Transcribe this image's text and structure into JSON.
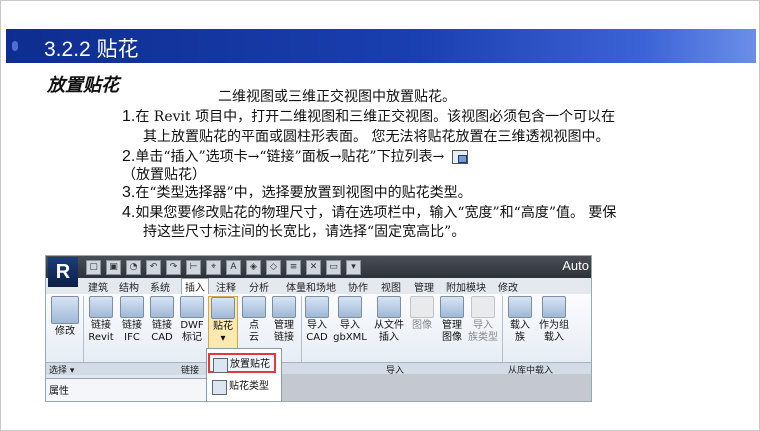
{
  "slide": {
    "title": "3.2.2 贴花",
    "heading": "放置贴花",
    "intro": "二维视图或三维正交视图中放置贴花。",
    "steps": [
      {
        "num": "1.",
        "line1": "在 Revit 项目中，打开二维视图和三维正交视图。该视图必须包含一个可以在",
        "line2": "其上放置贴花的平面或圆柱形表面。  您无法将贴花放置在三维透视视图中。"
      },
      {
        "num": "2.",
        "line1": "单击“插入”选项卡→“链接”面板→贴花”下拉列表→",
        "line2": "（放置贴花）"
      },
      {
        "num": "3.",
        "line1": "在“类型选择器”中，选择要放置到视图中的贴花类型。"
      },
      {
        "num": "4.",
        "line1": "如果您要修改贴花的物理尺寸，请在选项栏中，输入“宽度”和“高度”值。 要保",
        "line2": "持这些尺寸标注间的长宽比，请选择“固定宽高比”。"
      }
    ]
  },
  "revit": {
    "logo": "R",
    "app_title": "Auto",
    "tabs": [
      "建筑",
      "结构",
      "系统",
      "插入",
      "注释",
      "分析",
      "体量和场地",
      "协作",
      "视图",
      "管理",
      "附加模块",
      "修改"
    ],
    "active_tab": "插入",
    "buttons": {
      "modify": "修改",
      "link_revit": [
        "链接",
        "Revit"
      ],
      "link_ifc": [
        "链接",
        "IFC"
      ],
      "link_cad": [
        "链接",
        "CAD"
      ],
      "dwf": [
        "DWF",
        "标记"
      ],
      "decal": "贴花",
      "point_cloud": [
        "点",
        "云"
      ],
      "manage_links": [
        "管理",
        "链接"
      ],
      "import_cad": [
        "导入",
        "CAD"
      ],
      "import_gbxml": [
        "导入",
        "gbXML"
      ],
      "insert_from_file": [
        "从文件",
        "插入"
      ],
      "image": "图像",
      "manage_images": [
        "管理",
        "图像"
      ],
      "import_family_types": [
        "导入",
        "族类型"
      ],
      "load_family": [
        "载入",
        "族"
      ],
      "load_as_group": [
        "作为组",
        "载入"
      ]
    },
    "panels": {
      "select": "选择 ▾",
      "link": "链接",
      "import": "导入",
      "load_from_library": "从库中载入"
    },
    "dropdown": {
      "place_decal": "放置贴花",
      "decal_types": "贴花类型"
    },
    "properties": "属性"
  },
  "colors": {
    "banner": "#1a3fb0",
    "highlight_border": "#e03a3a"
  }
}
